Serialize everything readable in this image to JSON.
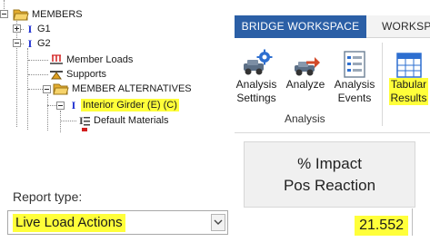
{
  "tree": {
    "members_label": "MEMBERS",
    "g1_label": "G1",
    "g2_label": "G2",
    "member_loads_label": "Member Loads",
    "supports_label": "Supports",
    "member_alternatives_label": "MEMBER ALTERNATIVES",
    "interior_girder_label": "Interior Girder (E) (C)",
    "default_materials_label": "Default Materials"
  },
  "ribbon": {
    "active_tab": "BRIDGE WORKSPACE",
    "inactive_tab": "WORKSPA",
    "buttons": {
      "analysis_settings_line1": "Analysis",
      "analysis_settings_line2": "Settings",
      "analyze": "Analyze",
      "analysis_events_line1": "Analysis",
      "analysis_events_line2": "Events",
      "tabular_results_line1": "Tabular",
      "tabular_results_line2": "Results"
    },
    "group_label": "Analysis"
  },
  "report": {
    "label": "Report type:",
    "selected": "Live Load Actions"
  },
  "impact": {
    "header_line1": "% Impact",
    "header_line2": "Pos Reaction",
    "value": "21.552"
  },
  "colors": {
    "highlight": "#ffff3a",
    "ribbon_blue": "#2b5fa6",
    "member_icon_blue": "#1e2fd0",
    "folder_yellow": "#f0c24a"
  }
}
